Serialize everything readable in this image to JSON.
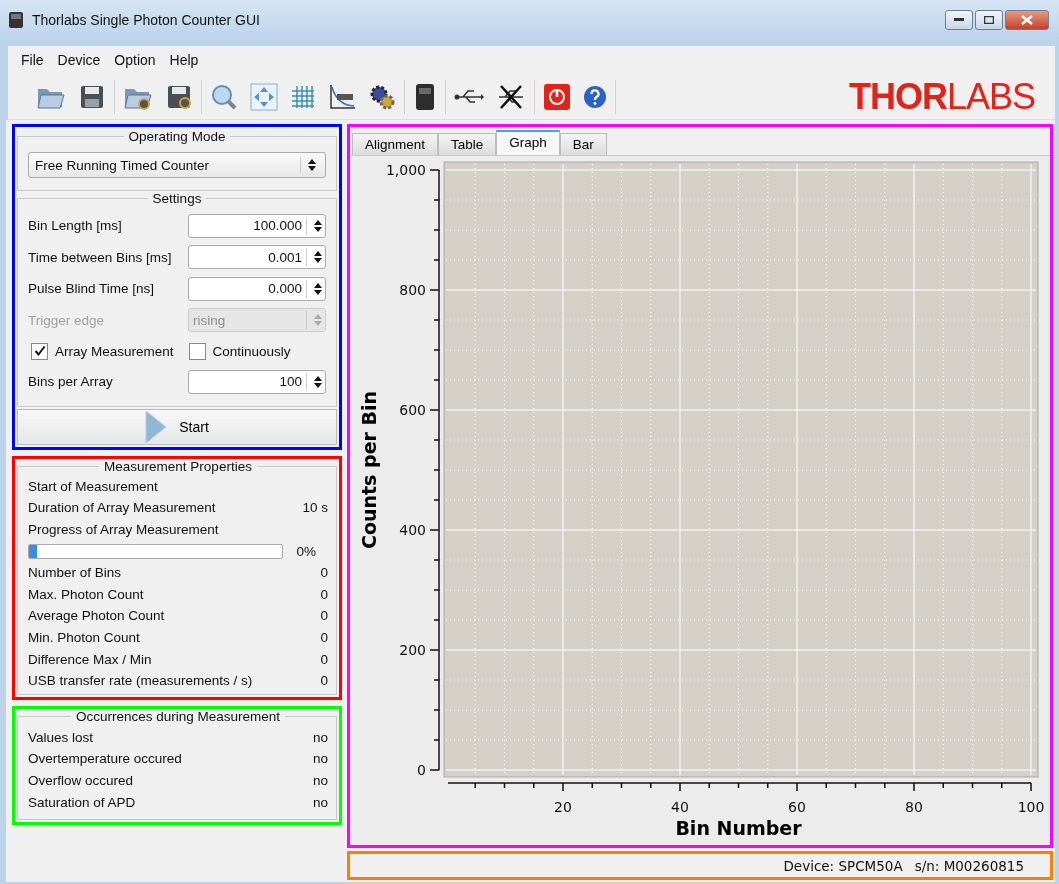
{
  "window": {
    "title": "Thorlabs Single Photon Counter GUI"
  },
  "menu": [
    "File",
    "Device",
    "Option",
    "Help"
  ],
  "toolbar": [
    [
      {
        "kind": "folder"
      },
      {
        "kind": "disk"
      }
    ],
    [
      {
        "kind": "folder-gear"
      },
      {
        "kind": "disk-gear"
      }
    ],
    [
      {
        "kind": "magnifier"
      },
      {
        "kind": "expand"
      },
      {
        "kind": "grid"
      },
      {
        "kind": "clear"
      },
      {
        "kind": "gear"
      }
    ],
    [
      {
        "kind": "device"
      }
    ],
    [
      {
        "kind": "usb"
      },
      {
        "kind": "usb-crossed"
      }
    ],
    [
      {
        "kind": "power"
      },
      {
        "kind": "help"
      }
    ]
  ],
  "logo": {
    "solid": "THOR",
    "outline": "LABS"
  },
  "operating_mode": {
    "title": "Operating Mode",
    "value": "Free Running Timed Counter"
  },
  "settings": {
    "title": "Settings",
    "rows": [
      {
        "kind": "spin",
        "label": "Bin Length [ms]",
        "value": "100.000",
        "disabled": false
      },
      {
        "kind": "spin",
        "label": "Time between Bins [ms]",
        "value": "0.001",
        "disabled": false
      },
      {
        "kind": "spin",
        "label": "Pulse Blind Time [ns]",
        "value": "0.000",
        "disabled": false
      },
      {
        "kind": "combo",
        "label": "Trigger edge",
        "value": "rising",
        "disabled": true
      },
      {
        "kind": "checks",
        "items": [
          {
            "label": "Array Measurement",
            "checked": true
          },
          {
            "label": "Continuously",
            "checked": false
          }
        ]
      },
      {
        "kind": "spin",
        "label": "Bins per Array",
        "value": "100",
        "disabled": false
      }
    ]
  },
  "start_button": "Start",
  "measurement": {
    "title": "Measurement Properties",
    "rows": [
      {
        "kind": "text",
        "label": "Start of Measurement"
      },
      {
        "kind": "text",
        "label": "Duration of Array Measurement",
        "value": "10 s"
      },
      {
        "kind": "text",
        "label": "Progress of Array Measurement"
      },
      {
        "kind": "progress",
        "level": 0.03,
        "reading": "0%"
      },
      {
        "kind": "text",
        "label": "Number of Bins",
        "value": "0"
      },
      {
        "kind": "text",
        "label": "Max. Photon Count",
        "value": "0"
      },
      {
        "kind": "text",
        "label": "Average Photon Count",
        "value": "0"
      },
      {
        "kind": "text",
        "label": "Min. Photon Count",
        "value": "0"
      },
      {
        "kind": "text",
        "label": "Difference Max / Min",
        "value": "0"
      },
      {
        "kind": "text",
        "label": "USB transfer rate (measurements / s)",
        "value": "0"
      }
    ]
  },
  "occurrences": {
    "title": "Occurrences during Measurement",
    "rows": [
      {
        "label": "Values lost",
        "value": "no"
      },
      {
        "label": "Overtemperature occured",
        "value": "no"
      },
      {
        "label": "Overflow occured",
        "value": "no"
      },
      {
        "label": "Saturation of APD",
        "value": "no"
      }
    ]
  },
  "tabs": [
    {
      "label": "Alignment",
      "selected": false
    },
    {
      "label": "Table",
      "selected": false
    },
    {
      "label": "Graph",
      "selected": true
    },
    {
      "label": "Bar",
      "selected": false
    }
  ],
  "chart_data": {
    "type": "line",
    "grid": true,
    "xlabel": "Bin Number",
    "ylabel": "Counts per Bin",
    "xlim": [
      0,
      100
    ],
    "ylim": [
      0,
      1000
    ],
    "xticks": [
      20,
      40,
      60,
      80,
      100
    ],
    "yticks": [
      0,
      200,
      400,
      600,
      800,
      {
        "value": 1000,
        "label": "1,000"
      }
    ]
  },
  "status_bar": {
    "device": "Device: SPCM50A",
    "serial": "s/n: M00260815"
  }
}
